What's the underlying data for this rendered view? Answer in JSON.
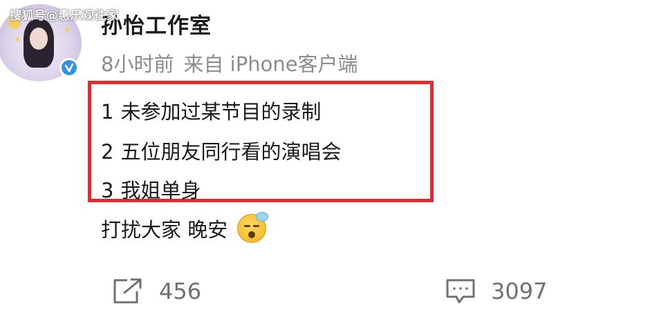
{
  "watermark": "搜狐号@惠乐观往家",
  "post": {
    "username": "孙怡工作室",
    "time": "8小时前",
    "source": "来自 iPhone客户端",
    "highlighted_lines": [
      {
        "num": "1",
        "text": "未参加过某节目的录制"
      },
      {
        "num": "2",
        "text": "五位朋友同行看的演唱会"
      },
      {
        "num": "3",
        "text": "我姐单身"
      }
    ],
    "closing_text": "打扰大家 晚安",
    "closing_emoji": "sleepy-face-emoji"
  },
  "actions": {
    "repost_count": "456",
    "comment_count": "3097"
  },
  "colors": {
    "highlight_border": "#e12b2f",
    "verified_badge": "#2f92e8",
    "meta_text": "#8c8c8c"
  },
  "icons": [
    "verified-badge-icon",
    "repost-icon",
    "comment-icon"
  ]
}
